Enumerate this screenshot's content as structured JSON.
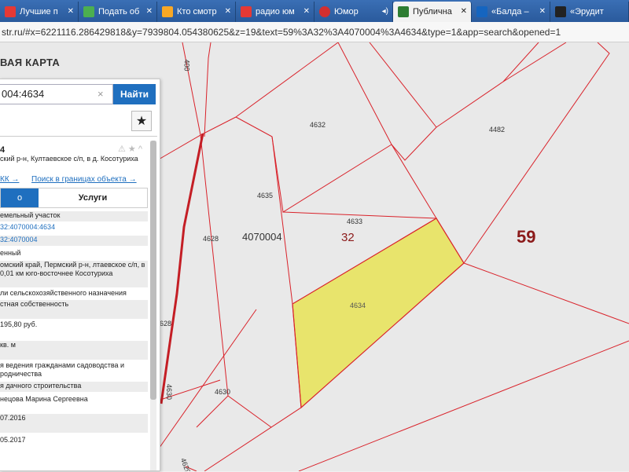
{
  "browser": {
    "tabs": [
      {
        "label": "Лучшие п",
        "color": "#e53935"
      },
      {
        "label": "Подать об",
        "color": "#4caf50"
      },
      {
        "label": "Кто смотр",
        "color": "#f9a825"
      },
      {
        "label": "радио юм",
        "color": "#e53935"
      },
      {
        "label": "Юмор",
        "color": "#d32f2f"
      },
      {
        "label": "Публична",
        "color": "#2e7d32",
        "active": true
      },
      {
        "label": "«Балда –",
        "color": "#1565c0"
      },
      {
        "label": "«Эрудит",
        "color": "#222222"
      }
    ],
    "url": "str.ru/#x=6221116.286429818&y=7939804.054380625&z=19&text=59%3A32%3A4070004%3A4634&type=1&app=search&opened=1"
  },
  "app": {
    "title": "ВАЯ КАРТА"
  },
  "search": {
    "value": "004:4634",
    "clear": "×",
    "button": "Найти"
  },
  "panel": {
    "star": "★",
    "head": "4",
    "head_icons": "⚠ ★ ^",
    "address": "ский р-н, Култаевское с/п, в д. Косотуриха",
    "link1": "КК →",
    "link2": "Поиск в границах объекта →",
    "tab_info": "о",
    "tab_services": "Услуги",
    "rows": [
      {
        "text": "емельный участок",
        "shade": true
      },
      {
        "text": "32:4070004:4634",
        "link": true
      },
      {
        "text": "32:4070004",
        "link": true,
        "shade": true
      },
      {
        "text": "енный"
      },
      {
        "text": "омский край, Пермский р-н, лтаевское с/п, в 0,01 км юго-восточнее Косотуриха",
        "shade": true
      },
      {
        "text": "ли сельскохозяйственного назначения"
      },
      {
        "text": "стная собственность",
        "shade": true
      },
      {
        "text": "195,80 руб."
      },
      {
        "text": "кв. м",
        "shade": true
      },
      {
        "text": "я ведения гражданами садоводства и родничества"
      },
      {
        "text": "я дачного строительства",
        "shade": true
      },
      {
        "text": "нецова Марина Сергеевна"
      },
      {
        "text": "07.2016",
        "shade": true
      },
      {
        "text": "05.2017"
      }
    ]
  },
  "map": {
    "parcel_labels": [
      "4632",
      "4482",
      "4635",
      "4633",
      "4628",
      "4634",
      "4630",
      "4629",
      "400",
      "628",
      "4630",
      "4629"
    ],
    "quarter_label": "4070004",
    "quarter_short": "32",
    "region_label": "59",
    "highlight_color": "#e8e46c",
    "line_color": "#d9222a"
  }
}
